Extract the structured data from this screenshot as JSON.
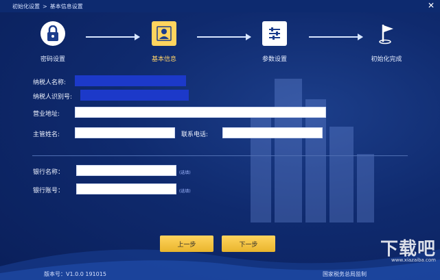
{
  "titlebar": {
    "crumb_root": "初始化设置",
    "sep": ">",
    "crumb_current": "基本信息设置",
    "close_glyph": "✕"
  },
  "steps": [
    {
      "label": "密码设置",
      "icon": "lock-icon"
    },
    {
      "label": "基本信息",
      "icon": "person-card-icon"
    },
    {
      "label": "参数设置",
      "icon": "sliders-icon"
    },
    {
      "label": "初始化完成",
      "icon": "flag-icon"
    }
  ],
  "form": {
    "taxpayer_name_label": "纳税人名称:",
    "taxpayer_name_value": "",
    "taxpayer_id_label": "纳税人识别号:",
    "taxpayer_id_value": "",
    "business_address_label": "营业地址:",
    "business_address_value": "",
    "manager_name_label": "主管姓名:",
    "manager_name_value": "",
    "phone_label": "联系电话:",
    "phone_value": "",
    "bank_name_label": "银行名称：",
    "bank_name_value": "",
    "bank_name_hint": "(选填)",
    "bank_account_label": "银行账号：",
    "bank_account_value": "",
    "bank_account_hint": "(选填)"
  },
  "buttons": {
    "prev": "上一步",
    "next": "下一步"
  },
  "footer": {
    "version": "版本号：V1.0.0 191015",
    "authority": "国家税务总局监制"
  },
  "watermark": {
    "text": "下载吧",
    "sub": "www.xiazaiba.com"
  },
  "colors": {
    "accent": "#ffd45e",
    "highlight_field": "#1c39c9",
    "background": "#0f2a6e"
  }
}
